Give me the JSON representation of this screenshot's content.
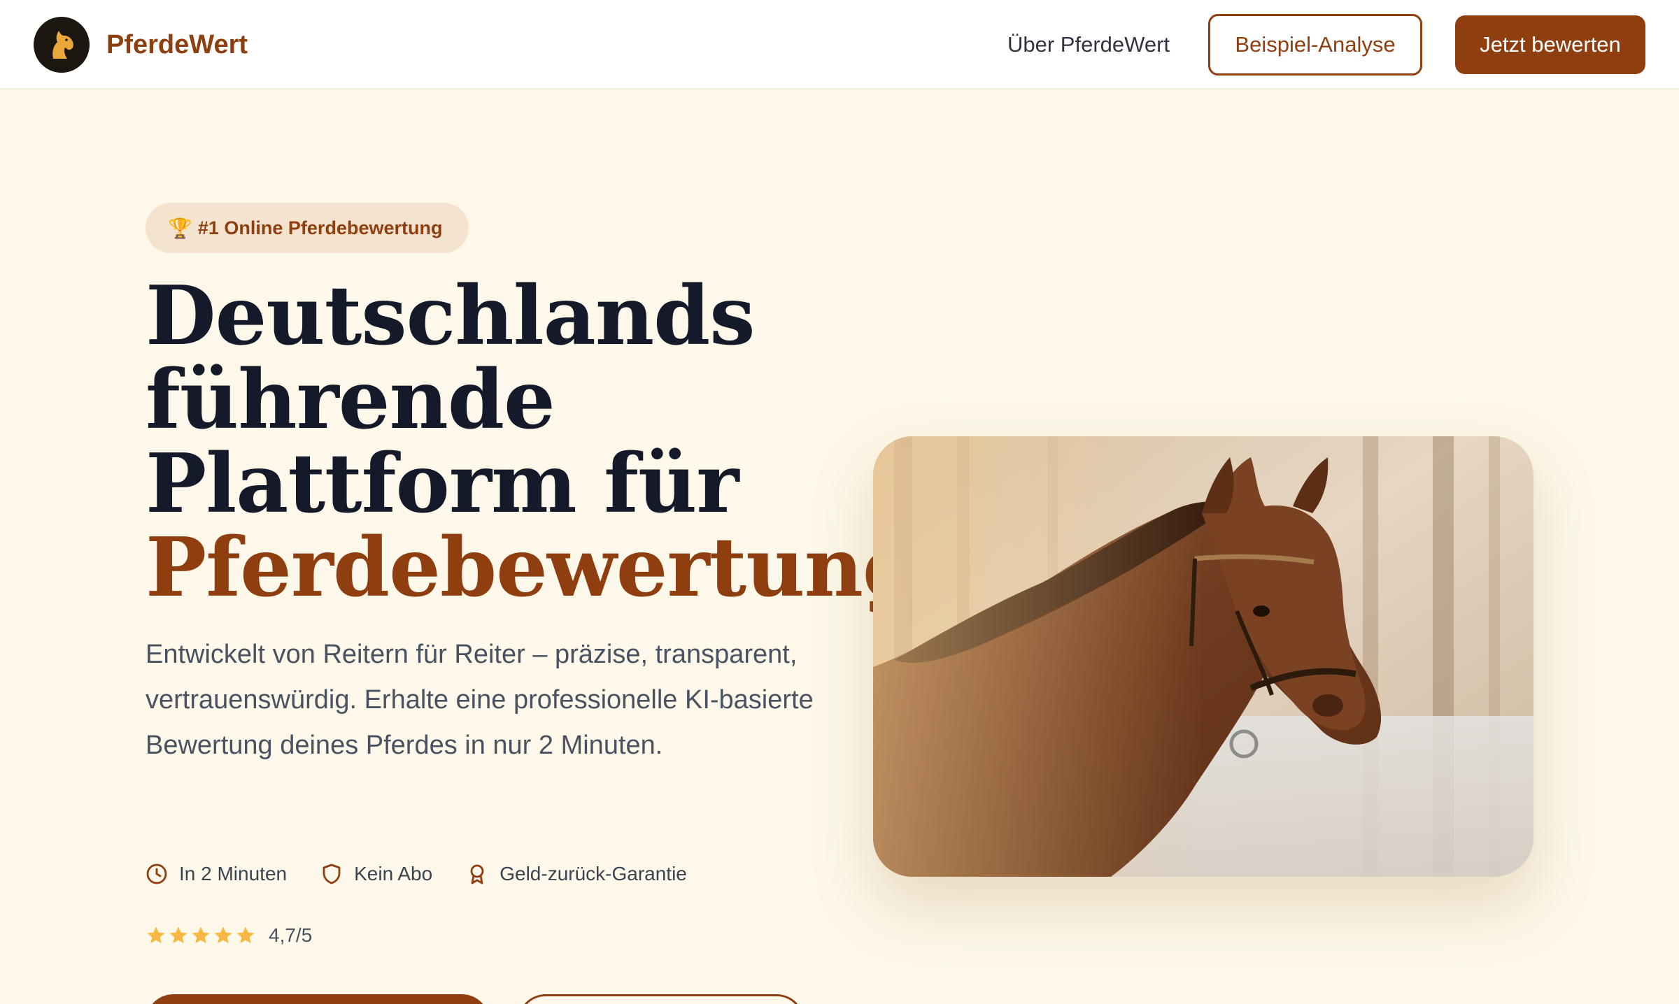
{
  "header": {
    "brand": "PferdeWert",
    "nav_about": "Über PferdeWert",
    "example_button": "Beispiel-Analyse",
    "cta_button": "Jetzt bewerten"
  },
  "hero": {
    "badge": "#1 Online Pferdebewertung",
    "headline_line1": "Deutschlands",
    "headline_line2": "führende",
    "headline_line3": "Plattform für",
    "headline_accent": "Pferdebewertung",
    "description": "Entwickelt von Reitern für Reiter – präzise, transparent, vertrauenswürdig. Erhalte eine professionelle KI-basierte Bewertung deines Pferdes in nur 2 Minuten.",
    "features": [
      {
        "label": "In 2 Minuten",
        "icon": "clock-icon"
      },
      {
        "label": "Kein Abo",
        "icon": "shield-icon"
      },
      {
        "label": "Geld-zurück-Garantie",
        "icon": "award-icon"
      }
    ],
    "rating": {
      "stars": 5,
      "value": "4,7/5"
    }
  },
  "colors": {
    "brand": "#8f3e10",
    "background": "#fdf8e9",
    "headline": "#141a29",
    "star": "#f5b942"
  }
}
